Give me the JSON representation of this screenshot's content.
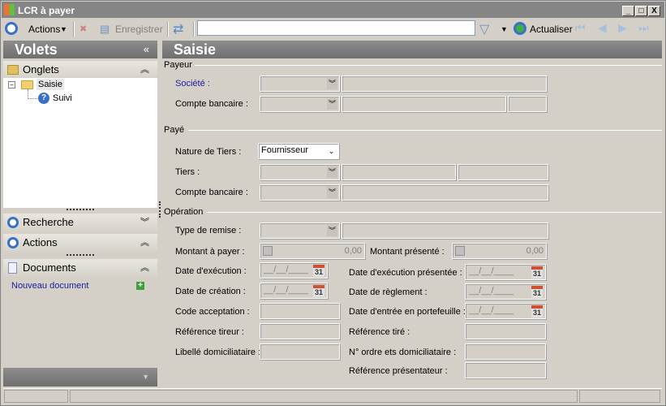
{
  "window": {
    "title": "LCR à payer",
    "min": "_",
    "max": "□",
    "close": "X"
  },
  "toolbar": {
    "actions": "Actions",
    "save": "Enregistrer",
    "search_value": "",
    "refresh": "Actualiser"
  },
  "left": {
    "title": "Volets",
    "collapse": "«",
    "onglets": "Onglets",
    "tree": [
      "Saisie",
      "Suivi"
    ],
    "recherche": "Recherche",
    "actions": "Actions",
    "documents": "Documents",
    "new_doc": "Nouveau document"
  },
  "main": {
    "title": "Saisie",
    "payeur": {
      "group": "Payeur",
      "societe": "Société :",
      "compte": "Compte bancaire  :"
    },
    "paye": {
      "group": "Payé",
      "nature": "Nature de Tiers :",
      "nature_value": "Fournisseur",
      "tiers": "Tiers :",
      "compte": "Compte bancaire :"
    },
    "operation": {
      "group": "Opération",
      "type": "Type de remise :",
      "montant_payer": "Montant à payer :",
      "montant_payer_value": "0,00",
      "montant_presente": "Montant présenté :",
      "montant_presente_value": "0,00",
      "date_exec": "Date d'exécution :",
      "date_creation": "Date de création :",
      "code_accept": "Code acceptation :",
      "ref_tireur": "Référence tireur :",
      "libelle": "Libellé domiciliataire :",
      "date_exec_pres": "Date d'exécution présentée :",
      "date_regl": "Date de règlement :",
      "date_entree": "Date d'entrée en portefeuille :",
      "ref_tire": "Référence tiré :",
      "n_ordre": "N° ordre ets domiciliataire :",
      "ref_pres": "Référence présentateur :",
      "date_mask": "__/__/____",
      "cal": "31"
    }
  }
}
